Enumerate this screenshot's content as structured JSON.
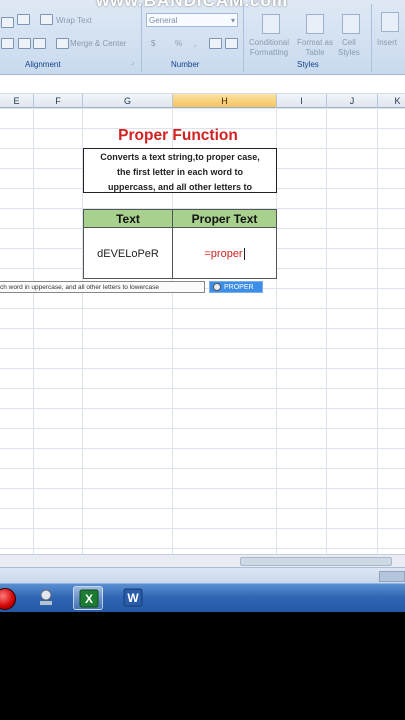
{
  "watermark": "www.BANDICAM.com",
  "ribbon": {
    "alignment": {
      "wrap_text": "Wrap Text",
      "merge_center": "Merge & Center",
      "label": "Alignment"
    },
    "number": {
      "format_value": "General",
      "currency": "$",
      "percent": "%",
      "comma": ",",
      "label": "Number"
    },
    "styles": {
      "conditional_formatting": [
        "Conditional",
        "Formatting"
      ],
      "format_as_table": [
        "Format as",
        "Table"
      ],
      "cell_styles": [
        "Cell",
        "Styles"
      ],
      "label": "Styles"
    },
    "insert": "Insert"
  },
  "columns": [
    {
      "name": "E",
      "selected": false
    },
    {
      "name": "F",
      "selected": false
    },
    {
      "name": "G",
      "selected": false
    },
    {
      "name": "H",
      "selected": true
    },
    {
      "name": "I",
      "selected": false
    },
    {
      "name": "J",
      "selected": false
    },
    {
      "name": "K",
      "selected": false
    }
  ],
  "sheet": {
    "title": "Proper Function",
    "description_lines": [
      "Converts a text string,to proper case,",
      "the first letter in each word to",
      "uppercass, and all other letters to"
    ],
    "table": {
      "headers": [
        "Text",
        "Proper Text"
      ],
      "rows": [
        [
          "dEVELoPeR",
          "=proper"
        ]
      ]
    }
  },
  "tooltip": {
    "text": "ch word in uppercase, and all other letters to lowercase"
  },
  "autocomplete": {
    "item": "PROPER"
  },
  "taskbar": {
    "apps": [
      "record-app",
      "network-app",
      "excel-app",
      "word-app"
    ],
    "active": "excel-app"
  },
  "colors": {
    "title": "#d32020",
    "header_fill": "#a9d18e",
    "formula": "#d32020",
    "selected_column": "#f6c35e",
    "taskbar": "#2f66b3"
  }
}
